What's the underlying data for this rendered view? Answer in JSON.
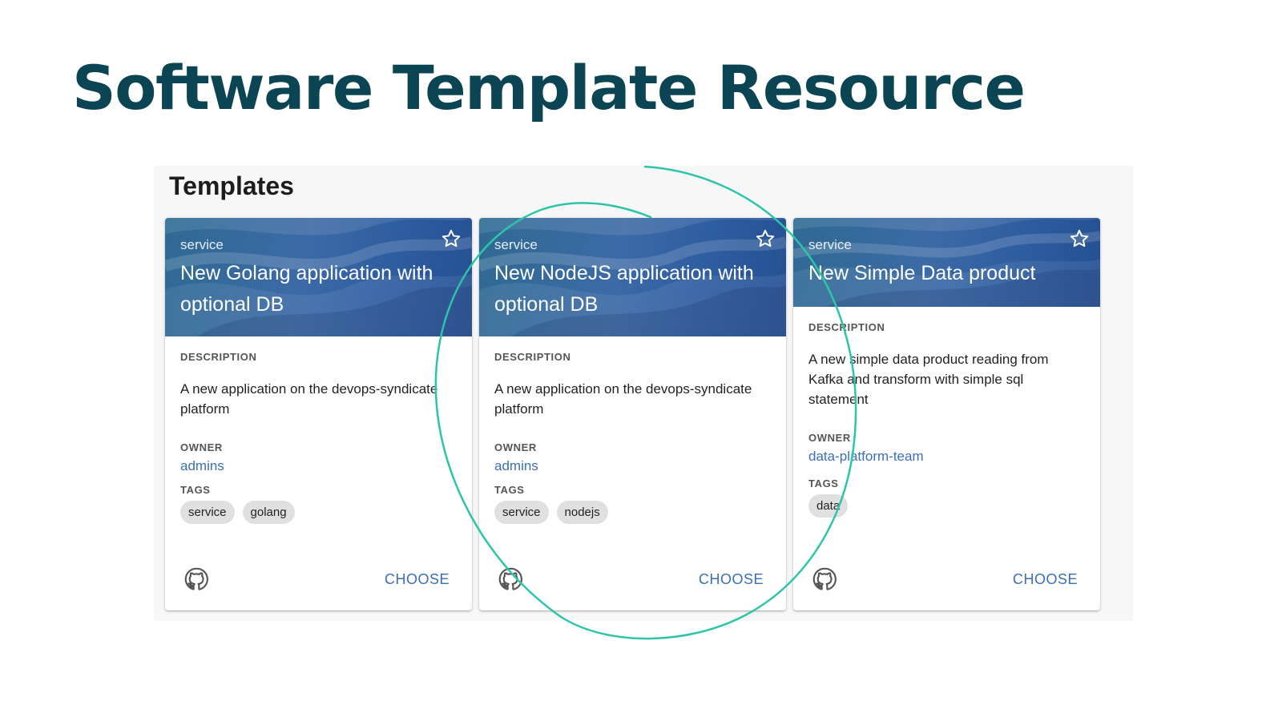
{
  "slide": {
    "title": "Software Template Resource"
  },
  "panel": {
    "heading": "Templates"
  },
  "labels": {
    "description": "DESCRIPTION",
    "owner": "OWNER",
    "tags": "TAGS",
    "choose": "CHOOSE"
  },
  "cards": [
    {
      "type": "service",
      "title": "New Golang application with optional DB",
      "description": "A new application on the devops-syndicate platform",
      "owner": "admins",
      "tags": [
        "service",
        "golang"
      ],
      "favorite": false
    },
    {
      "type": "service",
      "title": "New NodeJS application with optional DB",
      "description": "A new application on the devops-syndicate platform",
      "owner": "admins",
      "tags": [
        "service",
        "nodejs"
      ],
      "favorite": false
    },
    {
      "type": "service",
      "title": "New Simple Data product",
      "description": "A new simple data product reading from Kafka and transform with simple sql statement",
      "owner": "data-platform-team",
      "tags": [
        "data"
      ],
      "favorite": false
    }
  ],
  "icons": {
    "favorite": "star-outline-icon",
    "source": "github-icon"
  },
  "colors": {
    "title": "#0b4453",
    "header_gradient_start": "#2f6a93",
    "header_gradient_end": "#244f93",
    "link": "#3b6fb8",
    "highlight_circle": "#2ec4a8"
  }
}
